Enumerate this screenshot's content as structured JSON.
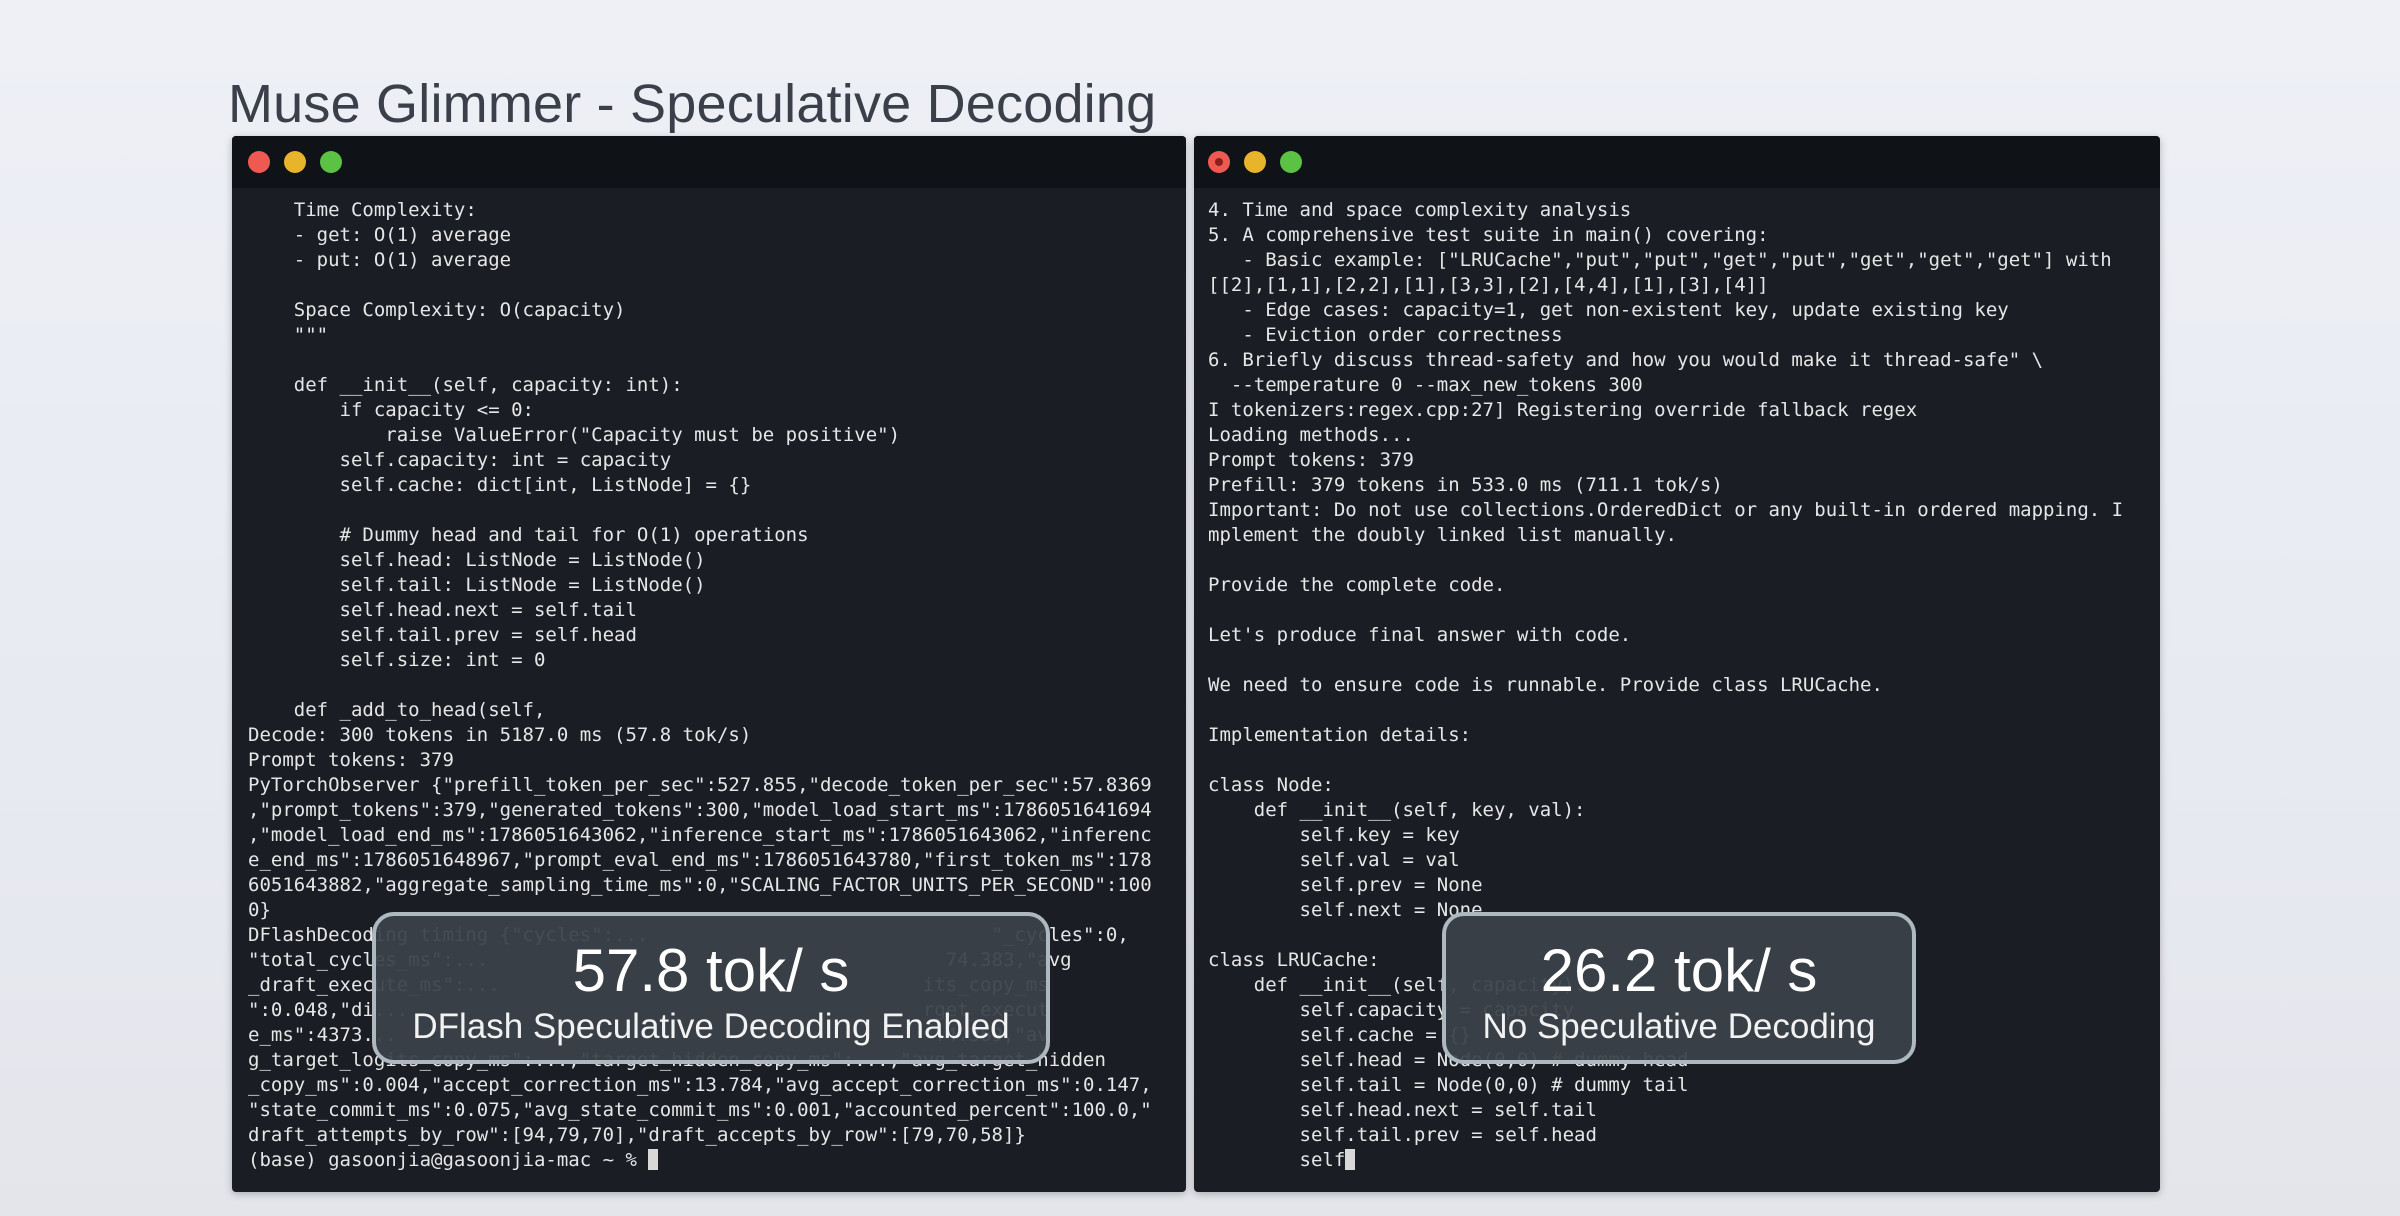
{
  "title": "Muse Glimmer - Speculative Decoding",
  "colors": {
    "terminal_bg": "#1a1e24",
    "titlebar_bg": "#0f1217",
    "traffic_red": "#ee5a52",
    "traffic_yellow": "#e8b42c",
    "traffic_green": "#5cc243",
    "badge_border": "#aeb8c0"
  },
  "left_terminal": {
    "lines": [
      "    Time Complexity:",
      "    - get: O(1) average",
      "    - put: O(1) average",
      "",
      "    Space Complexity: O(capacity)",
      "    \"\"\"",
      "",
      "    def __init__(self, capacity: int):",
      "        if capacity <= 0:",
      "            raise ValueError(\"Capacity must be positive\")",
      "        self.capacity: int = capacity",
      "        self.cache: dict[int, ListNode] = {}",
      "",
      "        # Dummy head and tail for O(1) operations",
      "        self.head: ListNode = ListNode()",
      "        self.tail: ListNode = ListNode()",
      "        self.head.next = self.tail",
      "        self.tail.prev = self.head",
      "        self.size: int = 0",
      "",
      "    def _add_to_head(self,",
      "Decode: 300 tokens in 5187.0 ms (57.8 tok/s)",
      "Prompt tokens: 379",
      "PyTorchObserver {\"prefill_token_per_sec\":527.855,\"decode_token_per_sec\":57.8369",
      ",\"prompt_tokens\":379,\"generated_tokens\":300,\"model_load_start_ms\":1786051641694",
      ",\"model_load_end_ms\":1786051643062,\"inference_start_ms\":1786051643062,\"inferenc",
      "e_end_ms\":1786051648967,\"prompt_eval_end_ms\":1786051643780,\"first_token_ms\":178",
      "6051643882,\"aggregate_sampling_time_ms\":0,\"SCALING_FACTOR_UNITS_PER_SECOND\":100",
      "0}",
      "DFlashDecoding timing {\"cycles\":...                              \"_cycles\":0,",
      "\"total_cycles_ms\":...                                        74.383,\"avg",
      "_draft_execute_ms\":...                                     its_copy_ms",
      "\":0.048,\"di...                                             rget_execut",
      "e_ms\":4373...                                              \":4.369,\"av",
      "g_target_logits_copy_ms\":...,\"target_hidden_copy_ms\":...,\"avg_target_hidden",
      "_copy_ms\":0.004,\"accept_correction_ms\":13.784,\"avg_accept_correction_ms\":0.147,",
      "\"state_commit_ms\":0.075,\"avg_state_commit_ms\":0.001,\"accounted_percent\":100.0,\"",
      "draft_attempts_by_row\":[94,79,70],\"draft_accepts_by_row\":[79,70,58]}"
    ],
    "prompt": "(base) gasoonjia@gasoonjia-mac ~ % "
  },
  "right_terminal": {
    "lines": [
      "4. Time and space complexity analysis",
      "5. A comprehensive test suite in main() covering:",
      "   - Basic example: [\"LRUCache\",\"put\",\"put\",\"get\",\"put\",\"get\",\"get\",\"get\"] with",
      "[[2],[1,1],[2,2],[1],[3,3],[2],[4,4],[1],[3],[4]]",
      "   - Edge cases: capacity=1, get non-existent key, update existing key",
      "   - Eviction order correctness",
      "6. Briefly discuss thread-safety and how you would make it thread-safe\" \\",
      "  --temperature 0 --max_new_tokens 300",
      "I tokenizers:regex.cpp:27] Registering override fallback regex",
      "Loading methods...",
      "Prompt tokens: 379",
      "Prefill: 379 tokens in 533.0 ms (711.1 tok/s)",
      "Important: Do not use collections.OrderedDict or any built-in ordered mapping. I",
      "mplement the doubly linked list manually.",
      "",
      "Provide the complete code.",
      "",
      "Let's produce final answer with code.",
      "",
      "We need to ensure code is runnable. Provide class LRUCache.",
      "",
      "Implementation details:",
      "",
      "class Node:",
      "    def __init__(self, key, val):",
      "        self.key = key",
      "        self.val = val",
      "        self.prev = None",
      "        self.next = None",
      "",
      "class LRUCache:",
      "    def __init__(self, capacity):",
      "        self.capacity = capacity",
      "        self.cache = {}",
      "        self.head = Node(0,0) # dummy head",
      "        self.tail = Node(0,0) # dummy tail",
      "        self.head.next = self.tail",
      "        self.tail.prev = self.head"
    ],
    "prompt": "        self"
  },
  "badges": {
    "left": {
      "speed": "57.8 tok/ s",
      "caption": "DFlash Speculative Decoding Enabled"
    },
    "right": {
      "speed": "26.2 tok/ s",
      "caption": "No Speculative Decoding"
    }
  }
}
